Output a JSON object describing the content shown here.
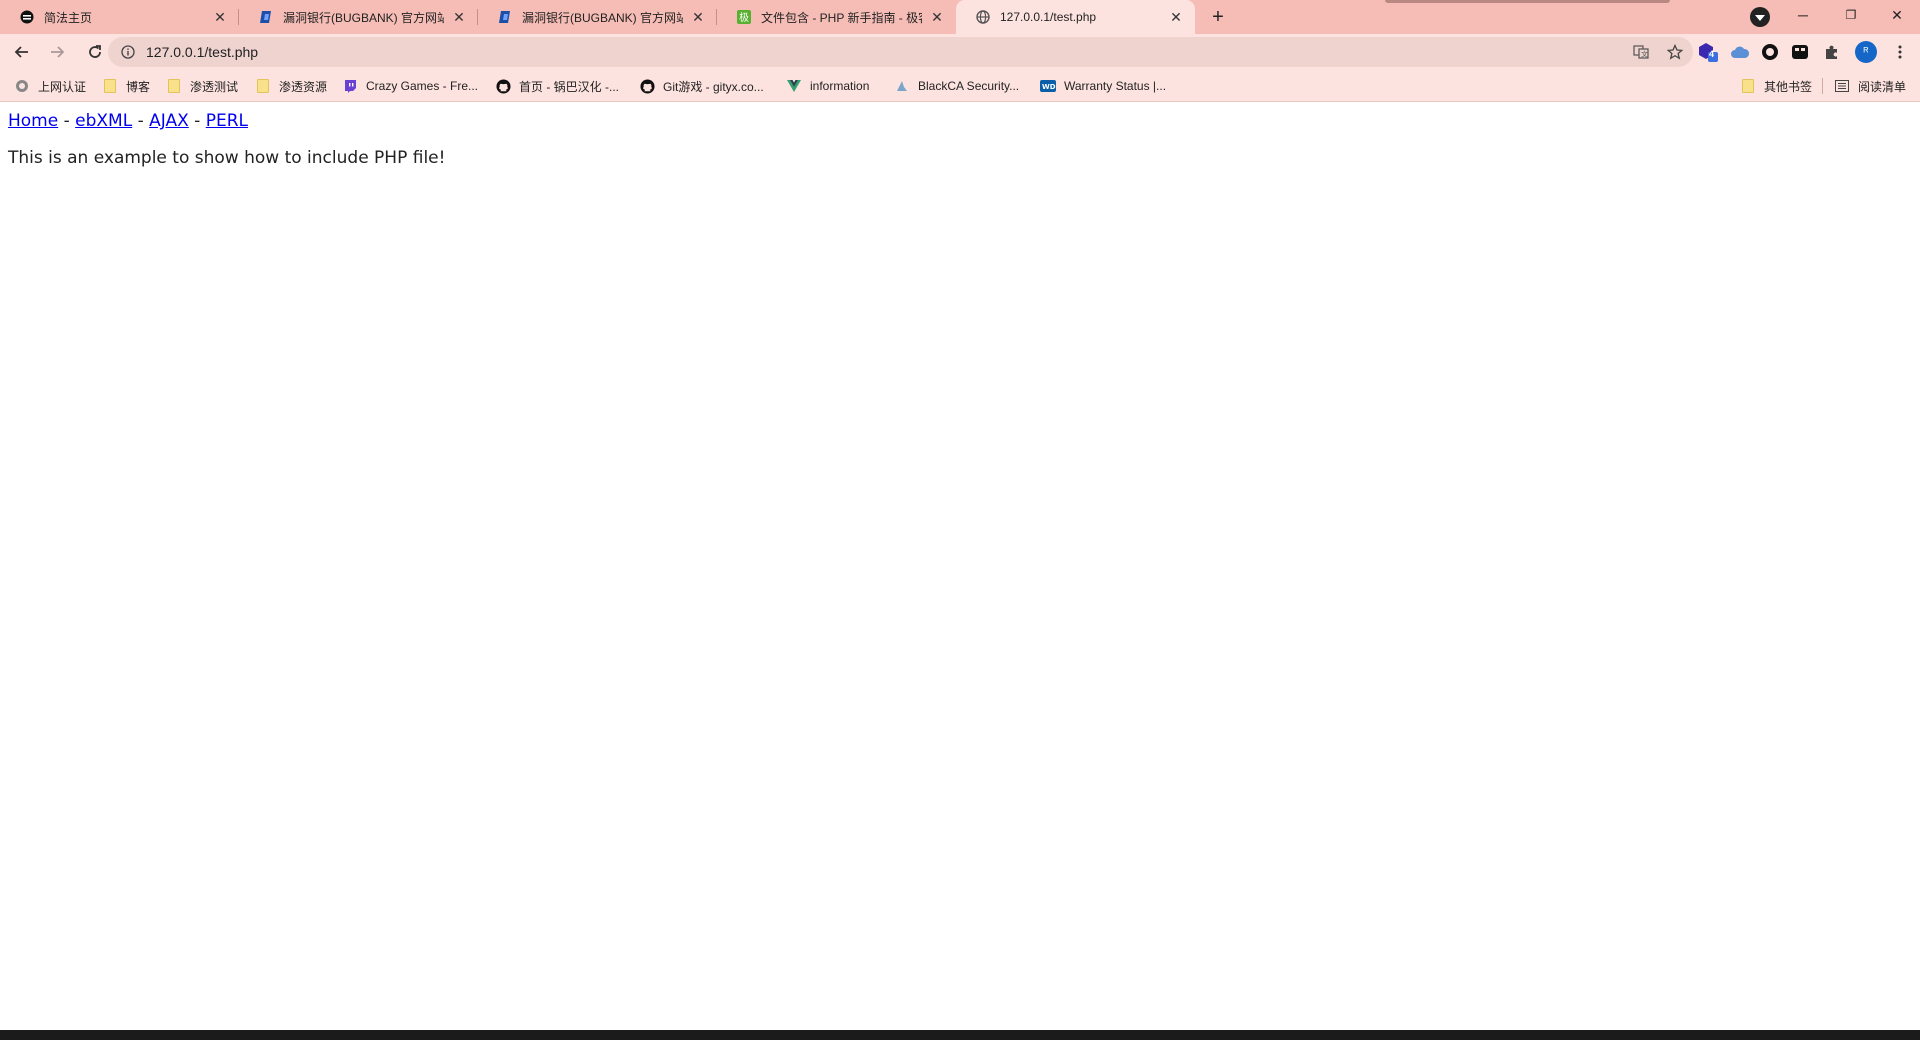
{
  "tabs": [
    {
      "title": "简法主页",
      "icon": "shield-icon"
    },
    {
      "title": "漏洞银行(BUGBANK) 官方网站 |",
      "icon": "bugbank-icon"
    },
    {
      "title": "漏洞银行(BUGBANK) 官方网站 |",
      "icon": "bugbank-icon"
    },
    {
      "title": "文件包含 - PHP 新手指南 - 极客",
      "icon": "jike-icon"
    },
    {
      "title": "127.0.0.1/test.php",
      "icon": "globe-icon",
      "active": true
    }
  ],
  "window": {
    "minimize": "─",
    "maximize": "❐",
    "close": "✕"
  },
  "toolbar": {
    "url": "127.0.0.1/test.php",
    "extension_badge": "4",
    "profile_initial": "ᴿ"
  },
  "bookmarks": [
    {
      "label": "上网认证",
      "icon": "globe-icon"
    },
    {
      "label": "博客",
      "icon": "folder-icon"
    },
    {
      "label": "渗透测试",
      "icon": "folder-icon"
    },
    {
      "label": "渗透资源",
      "icon": "folder-icon"
    },
    {
      "label": "Crazy Games - Fre...",
      "icon": "twitch-icon"
    },
    {
      "label": "首页 - 锅巴汉化 -...",
      "icon": "github-icon"
    },
    {
      "label": "Git游戏 - gityx.co...",
      "icon": "github-icon"
    },
    {
      "label": "information",
      "icon": "vue-icon"
    },
    {
      "label": "BlackCA Security...",
      "icon": "shark-icon"
    },
    {
      "label": "Warranty Status |...",
      "icon": "wd-icon"
    }
  ],
  "bookmarks_right": {
    "other": "其他书签",
    "reading_list": "阅读清单"
  },
  "page": {
    "nav_links": [
      "Home",
      "ebXML",
      "AJAX",
      "PERL"
    ],
    "separator": " - ",
    "body_text": "This is an example to show how to include PHP file!"
  }
}
